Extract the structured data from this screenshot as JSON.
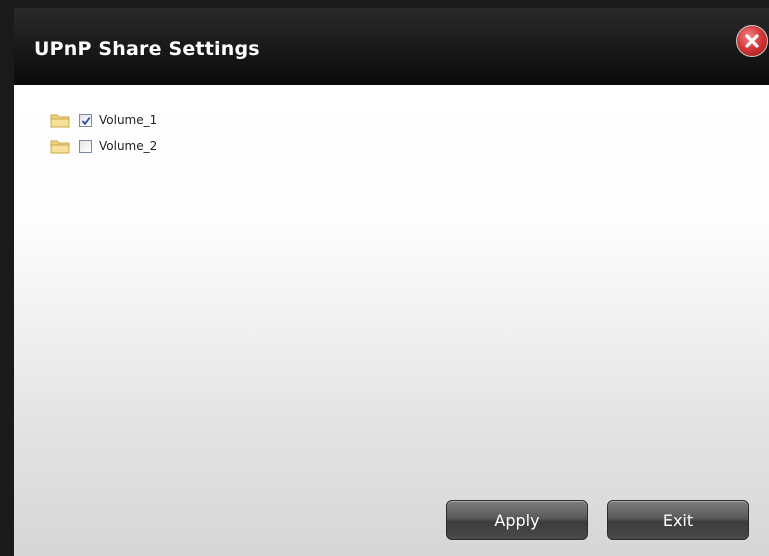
{
  "dialog": {
    "title": "UPnP Share Settings"
  },
  "volumes": [
    {
      "label": "Volume_1",
      "checked": true
    },
    {
      "label": "Volume_2",
      "checked": false
    }
  ],
  "buttons": {
    "apply": "Apply",
    "exit": "Exit"
  },
  "icons": {
    "close": "close-icon",
    "folder": "folder-icon",
    "check": "check-icon"
  },
  "colors": {
    "title_bar": "#0a0a0a",
    "close_button": "#d63a3a",
    "button": "#5a5a5a"
  }
}
